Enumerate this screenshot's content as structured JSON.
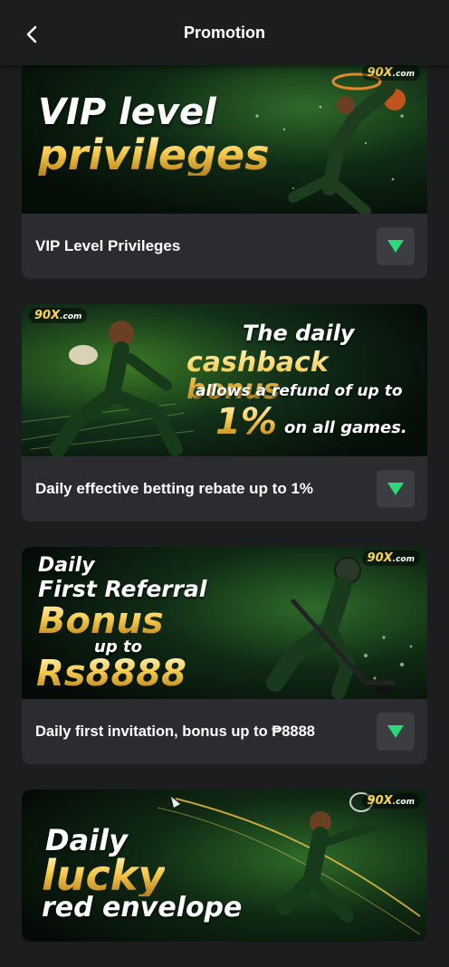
{
  "header": {
    "title": "Promotion",
    "back_icon": "chevron-left-icon"
  },
  "brand": {
    "mark": "90X",
    "suffix": ".com"
  },
  "cards": [
    {
      "banner": {
        "line1": "VIP level",
        "line2": "privileges"
      },
      "title": "VIP Level Privileges"
    },
    {
      "banner": {
        "line1": "The daily",
        "line2": "cashback bonus",
        "line3": "allows a refund of up to",
        "line4": "1%",
        "line5": "on all games."
      },
      "title": "Daily effective betting rebate up to 1%"
    },
    {
      "banner": {
        "line1": "Daily",
        "line2": "First Referral",
        "line3": "Bonus",
        "line4": "up to",
        "line5": "Rs8888"
      },
      "title": "Daily first invitation, bonus up to ₱8888"
    },
    {
      "banner": {
        "line1": "Daily",
        "line2": "lucky",
        "line3": "red envelope"
      },
      "title": ""
    }
  ],
  "colors": {
    "background": "#1c1d1f",
    "card": "#2b2c2f",
    "accent": "#2bd978",
    "gold": "#f6c94a"
  }
}
